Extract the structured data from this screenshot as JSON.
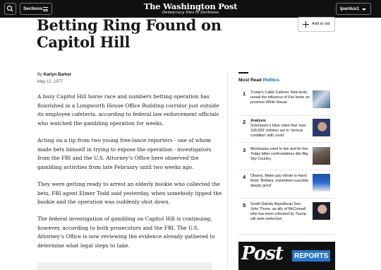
{
  "header": {
    "sections_label": "Sections",
    "masthead_title": "The Washington Post",
    "masthead_tagline": "Democracy Dies in Darkness",
    "user_label": "lpardus1"
  },
  "article": {
    "headline": "Betting Ring Found on Capitol Hill",
    "add_to_list_label": "Add to list",
    "byline_prefix": "By",
    "author": "Karlyn Barker",
    "date": "May 12, 1977",
    "paragraphs": [
      "A busy Capitol Hill horse race and numbers betting operation has flourished in a Longworth House Office Building corridor just outside its employee cafeteria, according to federal law enforcement officials who watched the gambling operation for weeks.",
      "Acting on a tip from two young free-lance reporters - one of whom made bets himself in trying to expose the operation - investigators from the FBI and the U.S. Attorney's Office here observed the gambling activities from late February until two weeks ago.",
      "They were getting ready to arrest an elderly bookie who collected the bets, FBI agent Elmer Todd said yesterday, when somebody tipped the bookie and the operation was suddenly shut down.",
      "The federal investigation of gambling on Capitol Hill is continuing, however, according to both prosecutors and the FBI. The U.S. Attorney's Office is now reviewing the evidence already gathered to determine what legal steps to take."
    ]
  },
  "most_read": {
    "title_prefix": "Most Read",
    "title_accent": "Politics",
    "accent_color": "#1955a5",
    "items": [
      {
        "num": "1",
        "kicker": "",
        "text": "Trump's Cable Cabinet: New texts reveal the influence of Fox hosts on previous White House"
      },
      {
        "num": "2",
        "kicker": "Analysis",
        "text": "Sotomayor's false claim that 'over 100,000' children are in 'serious condition' with covid"
      },
      {
        "num": "3",
        "kicker": "",
        "text": "Montanans used to live and let live. Today bitter confrontations dim Big Sky Country."
      },
      {
        "num": "4",
        "kicker": "",
        "text": "Obama, Biden pay tribute to Harry Reid: 'Brilliant, sometimes irascible, deeply good'"
      },
      {
        "num": "5",
        "kicker": "",
        "text": "South Dakota Republican Sen. John Thune, an ally of McConnell who has been criticized by Trump, will seek reelection"
      }
    ]
  },
  "promo": {
    "post_word": "Post",
    "reports_word": "REPORTS",
    "reports_color": "#2b77c9"
  }
}
